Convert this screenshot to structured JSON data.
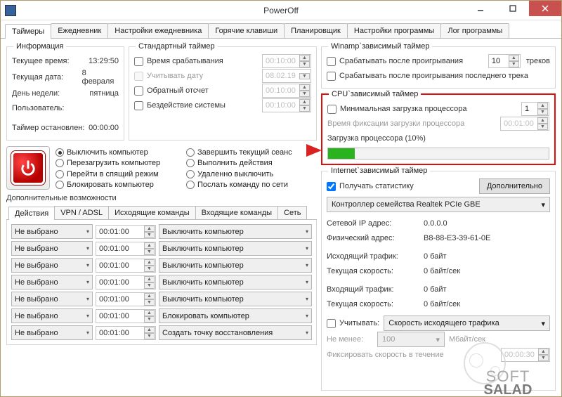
{
  "window": {
    "title": "PowerOff"
  },
  "tabs": [
    "Таймеры",
    "Ежедневник",
    "Настройки ежедневника",
    "Горячие клавиши",
    "Планировщик",
    "Настройки программы",
    "Лог программы"
  ],
  "info": {
    "legend": "Информация",
    "time_label": "Текущее время:",
    "time": "13:29:50",
    "date_label": "Текущая дата:",
    "date": "8 февраля",
    "dow_label": "День недели:",
    "dow": "пятница",
    "user_label": "Пользователь:",
    "user": "",
    "stopped_label": "Таймер остановлен:",
    "stopped": "00:00:00"
  },
  "std": {
    "legend": "Стандартный таймер",
    "fire_label": "Время срабатывания",
    "fire_val": "00:10:00",
    "date_label": "Учитывать дату",
    "date_val": "08.02.19",
    "countdown_label": "Обратный отсчет",
    "countdown_val": "00:10:00",
    "idle_label": "Бездействие системы",
    "idle_val": "00:10:00"
  },
  "actions": {
    "opts": [
      "Выключить компьютер",
      "Завершить текущий сеанс",
      "Перезагрузить компьютер",
      "Выполнить действия",
      "Перейти в спящий режим",
      "Удаленно выключить",
      "Блокировать компьютер",
      "Послать команду по сети"
    ]
  },
  "extra": {
    "legend": "Дополнительные возможности",
    "subtabs": [
      "Действия",
      "VPN / ADSL",
      "Исходящие команды",
      "Входящие команды",
      "Сеть"
    ],
    "rows": [
      {
        "sel": "Не выбрано",
        "t": "00:01:00",
        "act": "Выключить компьютер"
      },
      {
        "sel": "Не выбрано",
        "t": "00:01:00",
        "act": "Выключить компьютер"
      },
      {
        "sel": "Не выбрано",
        "t": "00:01:00",
        "act": "Выключить компьютер"
      },
      {
        "sel": "Не выбрано",
        "t": "00:01:00",
        "act": "Выключить компьютер"
      },
      {
        "sel": "Не выбрано",
        "t": "00:01:00",
        "act": "Выключить компьютер"
      },
      {
        "sel": "Не выбрано",
        "t": "00:01:00",
        "act": "Блокировать компьютер"
      },
      {
        "sel": "Не выбрано",
        "t": "00:01:00",
        "act": "Создать точку восстановления"
      }
    ]
  },
  "winamp": {
    "legend": "Winamp`зависимый таймер",
    "after_play": "Срабатывать после проигрывания",
    "tracks_val": "10",
    "tracks_unit": "треков",
    "after_last": "Срабатывать после проигрывания последнего трека"
  },
  "cpu": {
    "legend": "CPU`зависимый таймер",
    "minload": "Минимальная загрузка процессора",
    "minload_val": "1",
    "fixtime": "Время фиксации загрузки процессора",
    "fixtime_val": "00:01:00",
    "load_label": "Загрузка процессора (10%)",
    "load_pct": 10
  },
  "inet": {
    "legend": "Internet`зависимый таймер",
    "getstats": "Получать статистику",
    "more_btn": "Дополнительно",
    "adapter": "Контроллер семейства Realtek PCIe GBE",
    "ip_label": "Сетевой IP адрес:",
    "ip": "0.0.0.0",
    "mac_label": "Физический адрес:",
    "mac": "B8-88-E3-39-61-0E",
    "out_label": "Исходящий трафик:",
    "out": "0 байт",
    "outspd_label": "Текущая скорость:",
    "outspd": "0 байт/сек",
    "in_label": "Входящий трафик:",
    "in": "0 байт",
    "inspd_label": "Текущая скорость:",
    "inspd": "0 байт/сек",
    "count_label": "Учитывать:",
    "count_sel": "Скорость исходящего трафика",
    "min_label": "Не менее:",
    "min_val": "100",
    "min_unit": "Мбайт/сек",
    "fix_label": "Фиксировать скорость в течение",
    "fix_val": "00:00:30"
  }
}
